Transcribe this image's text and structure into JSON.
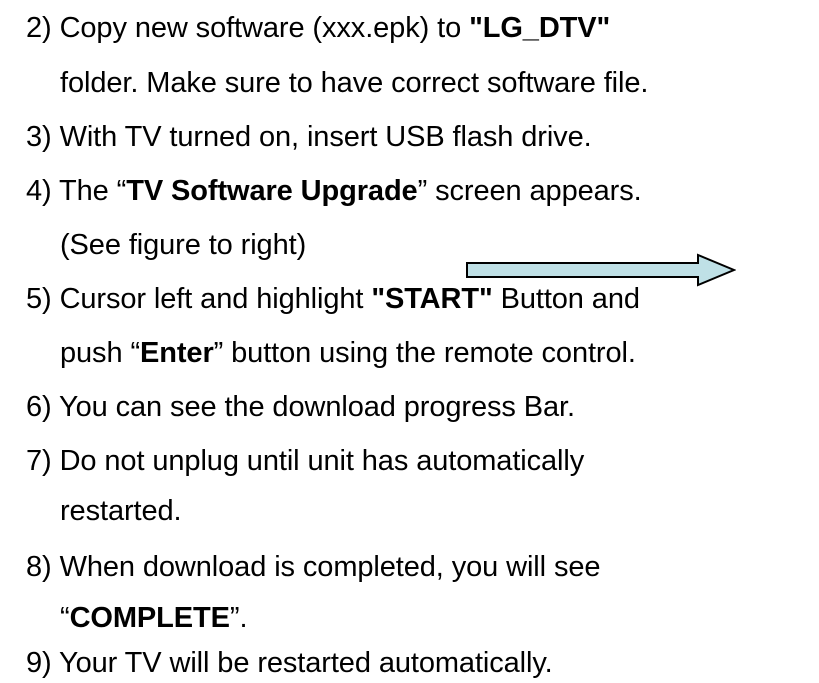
{
  "steps": [
    {
      "number": "2)",
      "lines": [
        {
          "parts": [
            "Copy new software (xxx.epk) to ",
            "\"",
            "LG_DTV",
            "\""
          ]
        },
        {
          "parts": [
            "folder. Make sure to have correct software file."
          ]
        }
      ]
    },
    {
      "number": "3)",
      "lines": [
        {
          "parts": [
            "With TV turned on, insert USB flash drive."
          ]
        }
      ]
    },
    {
      "number": "4)",
      "lines": [
        {
          "parts": [
            "The “",
            "TV Software Upgrade",
            "” screen appears."
          ]
        },
        {
          "parts": [
            "(See figure to right)"
          ]
        }
      ]
    },
    {
      "number": "5)",
      "lines": [
        {
          "parts": [
            "Cursor left and highlight ",
            "\"",
            "START",
            "\"",
            " Button and"
          ]
        },
        {
          "parts": [
            "push “",
            "Enter",
            "” button using the remote control."
          ]
        }
      ]
    },
    {
      "number": "6)",
      "lines": [
        {
          "parts": [
            "You can see the download progress Bar."
          ]
        }
      ]
    },
    {
      "number": "7)",
      "lines": [
        {
          "parts": [
            "Do not unplug until unit has automatically"
          ]
        },
        {
          "parts": [
            "restarted."
          ]
        }
      ]
    },
    {
      "number": "8)",
      "lines": [
        {
          "parts": [
            "When download is completed, you will see"
          ]
        },
        {
          "parts": [
            "“",
            "COMPLETE",
            "”."
          ]
        }
      ]
    },
    {
      "number": "9)",
      "lines": [
        {
          "parts": [
            "Your TV will be restarted automatically."
          ]
        }
      ]
    }
  ],
  "colors": {
    "text": "#000000",
    "arrow_fill": "#bfe0e6",
    "arrow_stroke": "#000000"
  },
  "icons": {
    "arrow": "right-arrow-icon"
  }
}
